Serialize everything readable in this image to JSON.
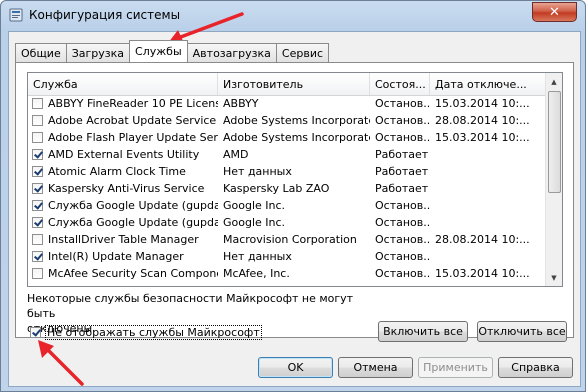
{
  "window": {
    "title": "Конфигурация системы",
    "close_symbol": "✕"
  },
  "tabs": [
    "Общие",
    "Загрузка",
    "Службы",
    "Автозагрузка",
    "Сервис"
  ],
  "active_tab": "Службы",
  "table": {
    "headers": [
      "Служба",
      "Изготовитель",
      "Состоя...",
      "Дата отключе..."
    ],
    "rows": [
      {
        "checked": false,
        "name": "ABBYY FineReader 10 PE Licensi...",
        "maker": "ABBYY",
        "state": "Останов...",
        "date": "15.03.2014 10:..."
      },
      {
        "checked": false,
        "name": "Adobe Acrobat Update Service",
        "maker": "Adobe Systems Incorporated",
        "state": "Останов...",
        "date": "28.08.2014 10:..."
      },
      {
        "checked": false,
        "name": "Adobe Flash Player Update Service",
        "maker": "Adobe Systems Incorporated",
        "state": "Останов...",
        "date": "15.03.2014 10:..."
      },
      {
        "checked": true,
        "name": "AMD External Events Utility",
        "maker": "AMD",
        "state": "Работает",
        "date": ""
      },
      {
        "checked": true,
        "name": "Atomic Alarm Clock Time",
        "maker": "Нет данных",
        "state": "Работает",
        "date": ""
      },
      {
        "checked": true,
        "name": "Kaspersky Anti-Virus Service",
        "maker": "Kaspersky Lab ZAO",
        "state": "Работает",
        "date": ""
      },
      {
        "checked": true,
        "name": "Служба Google Update (gupdate)",
        "maker": "Google Inc.",
        "state": "Останов...",
        "date": ""
      },
      {
        "checked": true,
        "name": "Служба Google Update (gupdate)",
        "maker": "Google Inc.",
        "state": "Останов...",
        "date": ""
      },
      {
        "checked": false,
        "name": "InstallDriver Table Manager",
        "maker": "Macrovision Corporation",
        "state": "Останов...",
        "date": "28.08.2014 10:..."
      },
      {
        "checked": true,
        "name": "Intel(R) Update Manager",
        "maker": "Нет данных",
        "state": "Останов...",
        "date": ""
      },
      {
        "checked": false,
        "name": "McAfee Security Scan Compone...",
        "maker": "McAfee, Inc.",
        "state": "Останов...",
        "date": "15.03.2014 10:..."
      }
    ]
  },
  "note_line1": "Некоторые службы безопасности Майкрософт не могут быть",
  "note_line2": "отключены.",
  "buttons": {
    "enable_all": "Включить все",
    "disable_all": "Отключить все",
    "ok": "OK",
    "cancel": "Отмена",
    "apply": "Применить",
    "help": "Справка"
  },
  "hide_ms_label": "Не отображать службы Майкрософт",
  "hide_ms_checked": true,
  "colors": {
    "annotation_arrow": "#e8232a",
    "close_button": "#c94a33"
  }
}
